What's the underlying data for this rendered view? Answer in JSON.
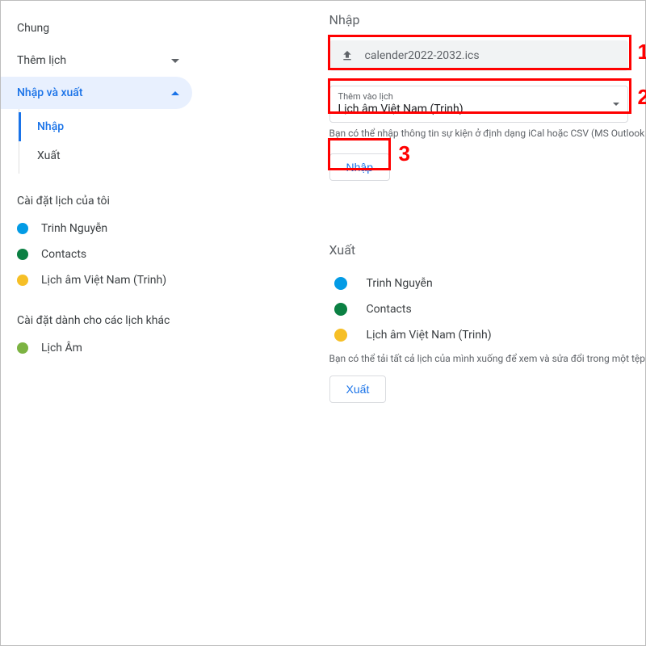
{
  "sidebar": {
    "general": "Chung",
    "add_calendar": "Thêm lịch",
    "import_export": "Nhập và xuất",
    "sub": {
      "import": "Nhập",
      "export": "Xuất"
    },
    "my_cals_heading": "Cài đặt lịch của tôi",
    "my_cals": [
      {
        "label": "Trinh Nguyễn",
        "color": "#039be5"
      },
      {
        "label": "Contacts",
        "color": "#0b8043"
      },
      {
        "label": "Lịch âm Việt Nam (Trinh)",
        "color": "#f6bf26"
      }
    ],
    "other_cals_heading": "Cài đặt dành cho các lịch khác",
    "other_cals": [
      {
        "label": "Lịch Âm",
        "color": "#7cb342"
      }
    ]
  },
  "import": {
    "title": "Nhập",
    "file": "calender2022-2032.ics",
    "select_label": "Thêm vào lịch",
    "select_value": "Lịch âm Việt Nam (Trinh)",
    "hint": "Bạn có thể nhập thông tin sự kiện ở định dạng iCal hoặc CSV (MS Outlook",
    "button": "Nhập"
  },
  "export": {
    "title": "Xuất",
    "items": [
      {
        "label": "Trinh Nguyễn",
        "color": "#039be5"
      },
      {
        "label": "Contacts",
        "color": "#0b8043"
      },
      {
        "label": "Lịch âm Việt Nam (Trinh)",
        "color": "#f6bf26"
      }
    ],
    "hint": "Bạn có thể tải tất cả lịch của mình xuống để xem và sửa đổi trong một tệp",
    "button": "Xuất"
  },
  "annotations": {
    "n1": "1",
    "n2": "2",
    "n3": "3"
  }
}
